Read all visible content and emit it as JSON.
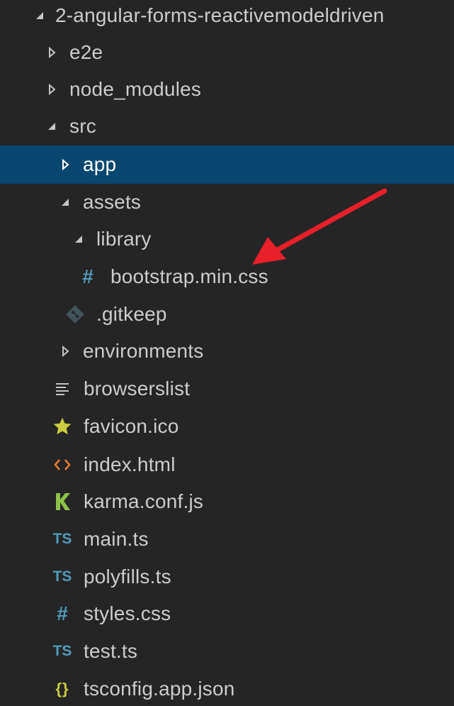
{
  "explorer": {
    "root": {
      "label": "2-angular-forms-reactivemodeldriven",
      "state": "expanded"
    },
    "items": [
      {
        "label": "e2e",
        "type": "folder",
        "state": "collapsed"
      },
      {
        "label": "node_modules",
        "type": "folder",
        "state": "collapsed"
      },
      {
        "label": "src",
        "type": "folder",
        "state": "expanded"
      },
      {
        "label": "app",
        "type": "folder",
        "state": "collapsed",
        "selected": true
      },
      {
        "label": "assets",
        "type": "folder",
        "state": "expanded"
      },
      {
        "label": "library",
        "type": "folder",
        "state": "expanded"
      },
      {
        "label": "bootstrap.min.css",
        "type": "file",
        "icon": "hash-icon",
        "icon_glyph": "#"
      },
      {
        "label": ".gitkeep",
        "type": "file",
        "icon": "git-icon"
      },
      {
        "label": "environments",
        "type": "folder",
        "state": "collapsed"
      },
      {
        "label": "browserslist",
        "type": "file",
        "icon": "lines-icon"
      },
      {
        "label": "favicon.ico",
        "type": "file",
        "icon": "star-icon"
      },
      {
        "label": "index.html",
        "type": "file",
        "icon": "code-brackets-icon"
      },
      {
        "label": "karma.conf.js",
        "type": "file",
        "icon": "karma-icon"
      },
      {
        "label": "main.ts",
        "type": "file",
        "icon": "typescript-icon",
        "icon_glyph": "TS"
      },
      {
        "label": "polyfills.ts",
        "type": "file",
        "icon": "typescript-icon",
        "icon_glyph": "TS"
      },
      {
        "label": "styles.css",
        "type": "file",
        "icon": "hash-icon",
        "icon_glyph": "#"
      },
      {
        "label": "test.ts",
        "type": "file",
        "icon": "typescript-icon",
        "icon_glyph": "TS"
      },
      {
        "label": "tsconfig.app.json",
        "type": "file",
        "icon": "json-braces-icon",
        "icon_glyph": "{}"
      }
    ]
  },
  "colors": {
    "background": "#252526",
    "selection": "#094771",
    "text": "#cccccc",
    "css_icon": "#519aba",
    "ts_icon": "#519aba",
    "html_icon": "#e37933",
    "favicon_icon": "#cbcb41",
    "karma_icon": "#8dc149",
    "json_icon": "#cbcb41",
    "git_icon": "#41535b",
    "arrow": "#e8202a"
  }
}
